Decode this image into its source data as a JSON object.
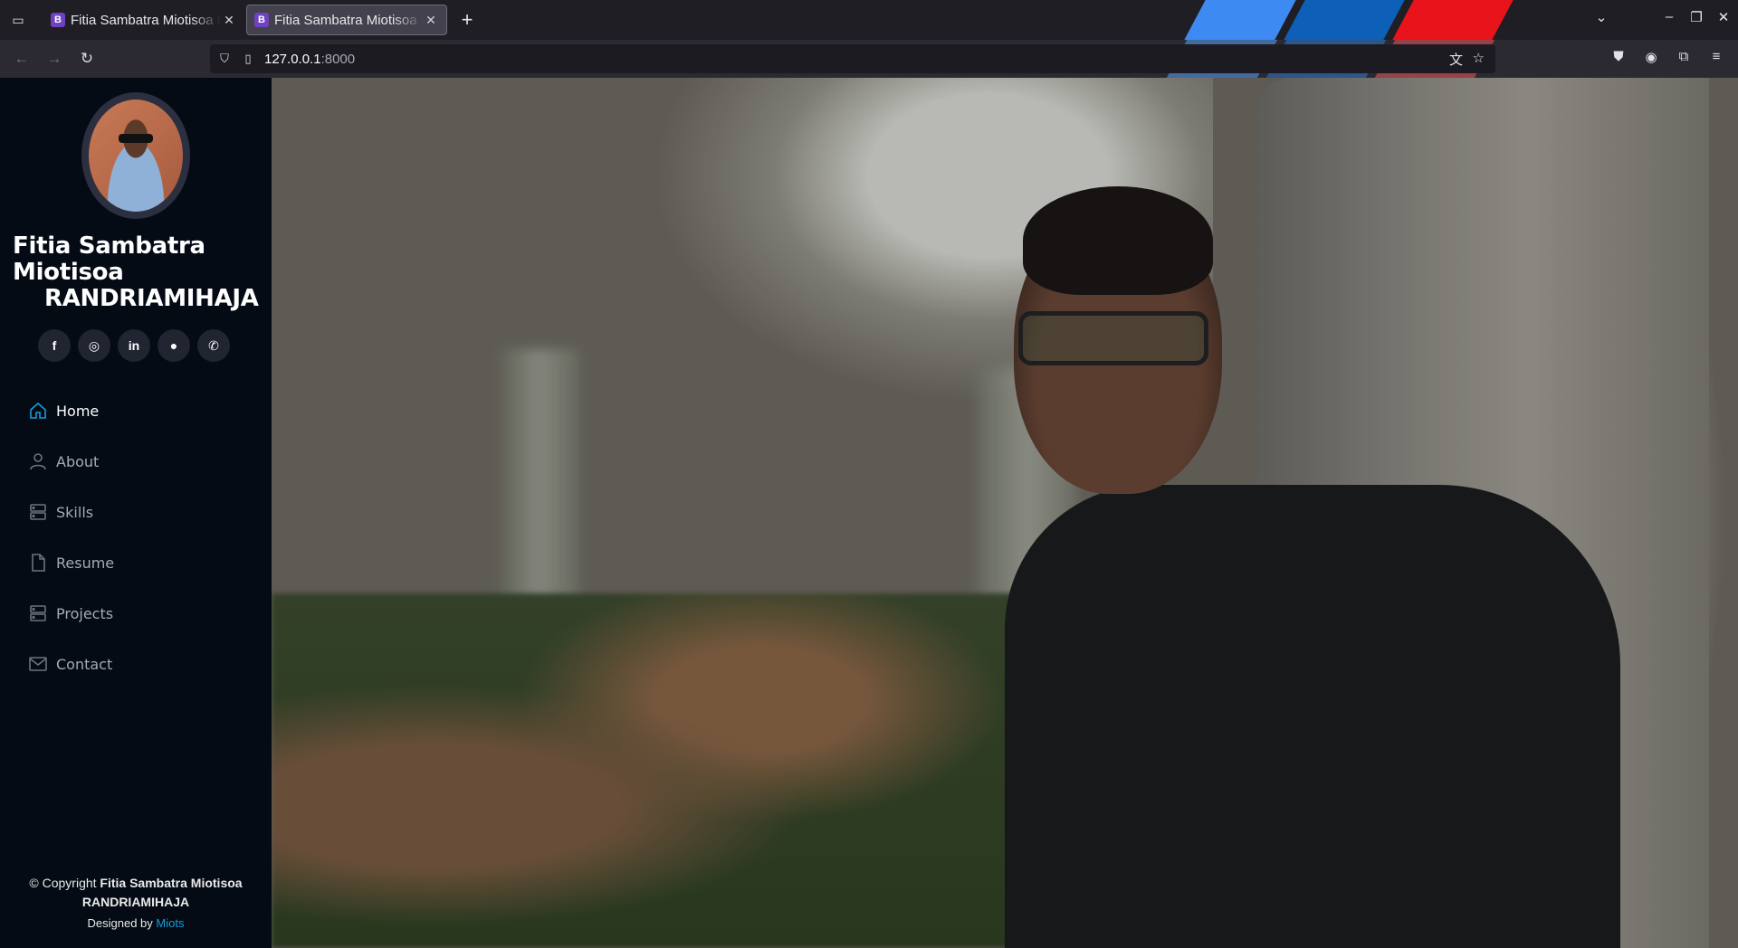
{
  "browser": {
    "tabs": [
      {
        "title": "Fitia Sambatra Miotisoa RANDRIAMIHAJA",
        "favicon": "B",
        "active": false
      },
      {
        "title": "Fitia Sambatra Miotisoa RANDRIAMIHAJA",
        "favicon": "B",
        "active": true
      }
    ],
    "url_host": "127.0.0.1",
    "url_port": ":8000"
  },
  "profile": {
    "name_line1": "Fitia Sambatra",
    "name_line2": "Miotisoa",
    "name_line3": "RANDRIAMIHAJA"
  },
  "social": [
    {
      "icon": "facebook-icon",
      "glyph": "f"
    },
    {
      "icon": "instagram-icon",
      "glyph": "◎"
    },
    {
      "icon": "linkedin-icon",
      "glyph": "in"
    },
    {
      "icon": "github-icon",
      "glyph": "●"
    },
    {
      "icon": "whatsapp-icon",
      "glyph": "✆"
    }
  ],
  "menu": {
    "items": [
      {
        "label": "Home",
        "icon": "house-icon",
        "active": true
      },
      {
        "label": "About",
        "icon": "person-icon",
        "active": false
      },
      {
        "label": "Skills",
        "icon": "server-icon",
        "active": false
      },
      {
        "label": "Resume",
        "icon": "file-icon",
        "active": false
      },
      {
        "label": "Projects",
        "icon": "server-icon",
        "active": false
      },
      {
        "label": "Contact",
        "icon": "envelope-icon",
        "active": false
      }
    ]
  },
  "footer": {
    "copyright_prefix": "© Copyright ",
    "copyright_name": "Fitia Sambatra Miotisoa RANDRIAMIHAJA",
    "designed_prefix": "Designed by ",
    "designer": "Miots"
  },
  "colors": {
    "sidebar_bg": "#040b14",
    "accent": "#149ddd",
    "social_bg": "#212431"
  }
}
